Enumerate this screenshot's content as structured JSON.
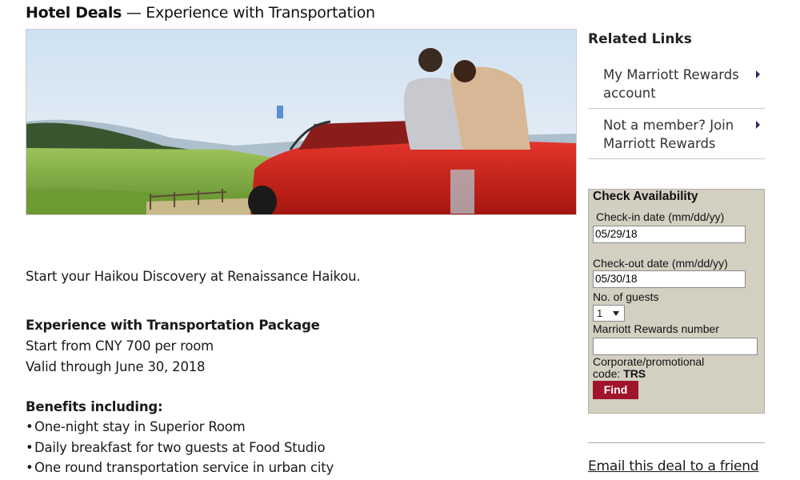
{
  "header": {
    "title_bold": "Hotel Deals",
    "title_rest": " — Experience with Transportation"
  },
  "hero": {
    "image": "couple-on-red-convertible-landscape"
  },
  "main": {
    "intro": "Start your Haikou Discovery at Renaissance Haikou.",
    "package_title": "Experience with Transportation Package",
    "price_line": "Start from CNY 700 per room",
    "valid_line": "Valid through June 30, 2018",
    "benefits_title": "Benefits including:",
    "benefits": [
      "One-night stay in Superior Room",
      "Daily breakfast for two guests at Food Studio",
      "One round transportation service in urban city"
    ]
  },
  "sidebar": {
    "related_title": "Related Links",
    "links": [
      {
        "label": "My Marriott Rewards account"
      },
      {
        "label": "Not a member? Join Marriott Rewards"
      }
    ],
    "check": {
      "title": "Check Availability",
      "checkin_label": "Check-in date (mm/dd/yy)",
      "checkin_value": "05/29/18",
      "checkout_label": "Check-out date (mm/dd/yy)",
      "checkout_value": "05/30/18",
      "guests_label": "No. of guests",
      "guests_value": "1",
      "rewards_label": "Marriott Rewards number",
      "rewards_value": "",
      "promo_label": "Corporate/promotional",
      "promo_code_prefix": "code: ",
      "promo_code": "TRS",
      "find_label": "Find"
    },
    "email_link": "Email this deal to a friend"
  },
  "colors": {
    "accent": "#a0142c",
    "panel": "#d3d0c2",
    "car_red": "#d42a22"
  }
}
